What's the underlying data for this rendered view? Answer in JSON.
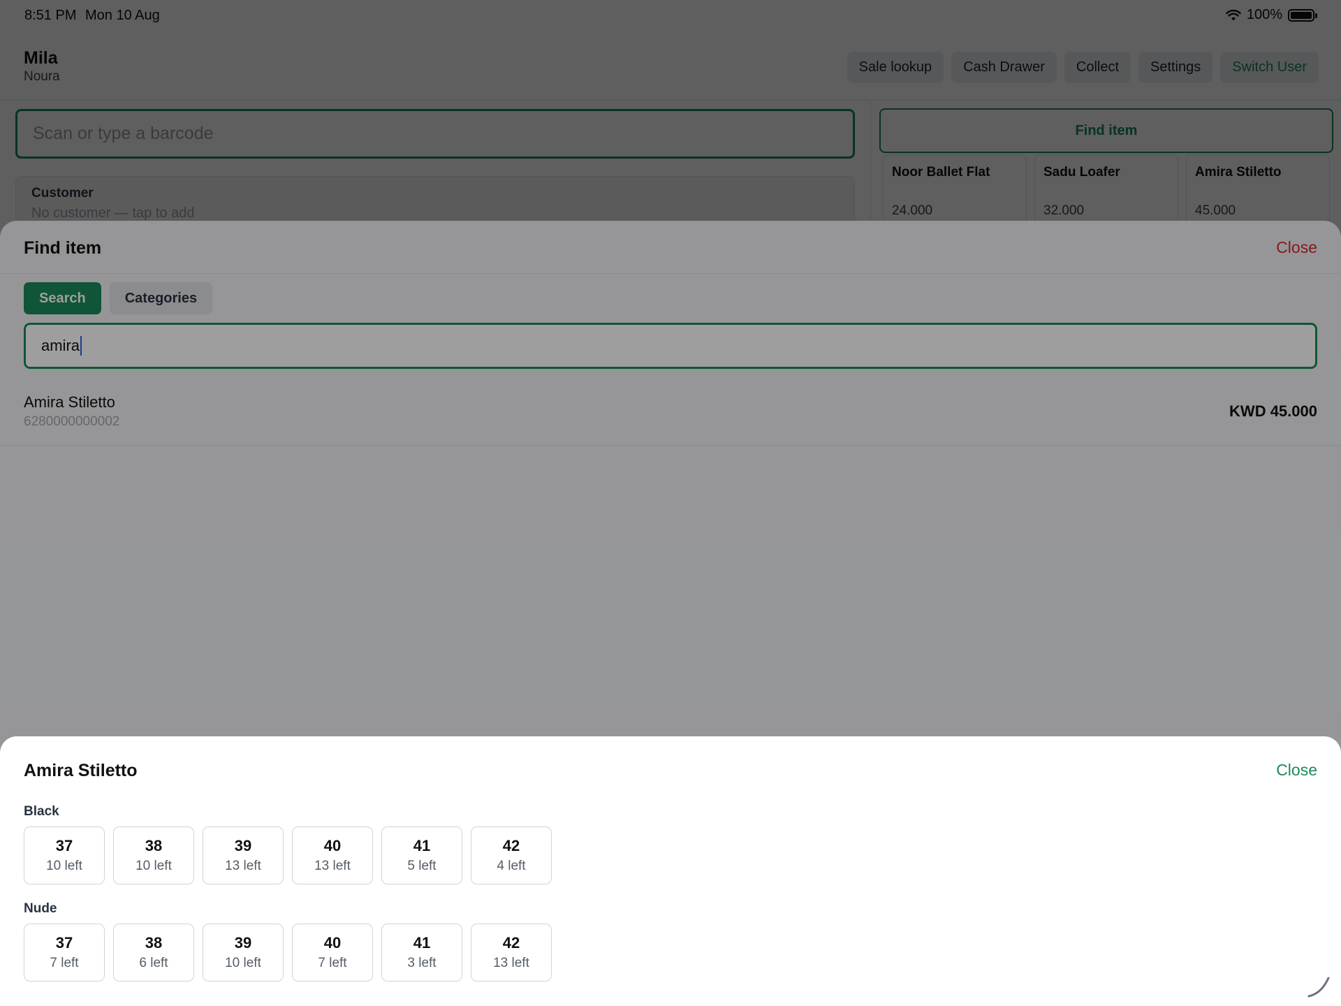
{
  "status_bar": {
    "time": "8:51 PM",
    "date": "Mon 10 Aug",
    "battery": "100%"
  },
  "header": {
    "user_name": "Mila",
    "user_sub": "Noura",
    "nav": [
      "Sale lookup",
      "Cash Drawer",
      "Collect",
      "Settings",
      "Switch User"
    ]
  },
  "barcode": {
    "placeholder": "Scan or type a barcode"
  },
  "customer": {
    "title": "Customer",
    "hint": "No customer — tap to add"
  },
  "find_button": {
    "label": "Find item"
  },
  "quick_products": [
    {
      "name": "Noor Ballet Flat",
      "price": "24.000"
    },
    {
      "name": "Sadu Loafer",
      "price": "32.000"
    },
    {
      "name": "Amira Stiletto",
      "price": "45.000"
    }
  ],
  "find_sheet": {
    "title": "Find item",
    "close": "Close",
    "tabs": [
      {
        "label": "Search",
        "active": true
      },
      {
        "label": "Categories",
        "active": false
      }
    ],
    "query": "amira",
    "results": [
      {
        "name": "Amira Stiletto",
        "code": "6280000000002",
        "price": "KWD 45.000"
      }
    ]
  },
  "variant_sheet": {
    "title": "Amira Stiletto",
    "close": "Close",
    "colors": [
      {
        "name": "Black",
        "sizes": [
          {
            "size": "37",
            "left": "10 left"
          },
          {
            "size": "38",
            "left": "10 left"
          },
          {
            "size": "39",
            "left": "13 left"
          },
          {
            "size": "40",
            "left": "13 left"
          },
          {
            "size": "41",
            "left": "5 left"
          },
          {
            "size": "42",
            "left": "4 left"
          }
        ]
      },
      {
        "name": "Nude",
        "sizes": [
          {
            "size": "37",
            "left": "7 left"
          },
          {
            "size": "38",
            "left": "6 left"
          },
          {
            "size": "39",
            "left": "10 left"
          },
          {
            "size": "40",
            "left": "7 left"
          },
          {
            "size": "41",
            "left": "3 left"
          },
          {
            "size": "42",
            "left": "13 left"
          }
        ]
      }
    ]
  },
  "colors": {
    "accent": "#1a8a5a",
    "danger": "#d42b2b"
  }
}
